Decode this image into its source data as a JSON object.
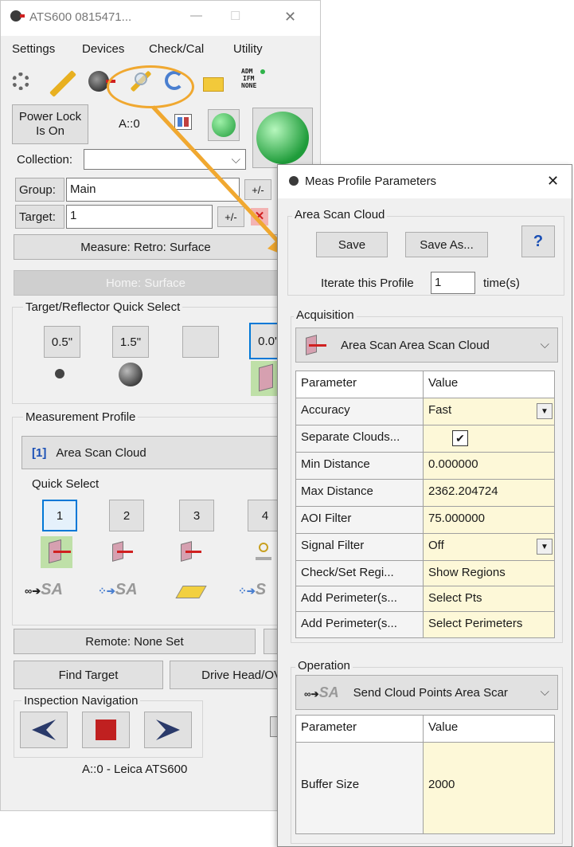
{
  "main": {
    "title": "ATS600 0815471...",
    "window_controls": {
      "minimize": "—",
      "maximize": "☐",
      "close": "✕"
    },
    "menu": [
      "Settings",
      "Devices",
      "Check/Cal",
      "Utility"
    ],
    "status_lines": [
      "ADM",
      "IFM",
      "NONE"
    ],
    "power_lock": [
      "Power Lock",
      "Is On"
    ],
    "station_label": "A::0",
    "collection_label": "Collection:",
    "collection_value": "",
    "group_label": "Group:",
    "group_value": "Main",
    "target_label": "Target:",
    "target_value": "1",
    "plusminus": "+/-",
    "measure_button": "Measure: Retro: Surface",
    "home_button": "Home: Surface",
    "quick_select_title": "Target/Reflector Quick Select",
    "target_buttons": [
      "0.5\"",
      "1.5\"",
      "",
      "0.0'"
    ],
    "profile_title": "Measurement Profile",
    "profile_index": "[1]",
    "profile_name": "Area Scan Cloud",
    "quick_select_label": "Quick Select",
    "quick_buttons": [
      "1",
      "2",
      "3",
      "4"
    ],
    "remote_button": "Remote: None Set",
    "find_target": "Find Target",
    "drive_head": "Drive Head/OV",
    "inspection_nav": "Inspection Navigation",
    "footer": "A::0 - Leica ATS600"
  },
  "dialog": {
    "title": "Meas Profile Parameters",
    "close": "✕",
    "section_title": "Area Scan Cloud",
    "save": "Save",
    "save_as": "Save As...",
    "help": "?",
    "iterate_label": "Iterate this Profile",
    "iterate_value": "1",
    "iterate_unit": "time(s)",
    "acquisition_label": "Acquisition",
    "acquisition_value": "Area Scan Area Scan Cloud",
    "param_header": "Parameter",
    "value_header": "Value",
    "params": [
      {
        "name": "Accuracy",
        "value": "Fast"
      },
      {
        "name": "Separate Clouds...",
        "value": "✔"
      },
      {
        "name": "Min Distance",
        "value": "0.000000"
      },
      {
        "name": "Max Distance",
        "value": "2362.204724"
      },
      {
        "name": "AOI Filter",
        "value": "75.000000"
      },
      {
        "name": "Signal Filter",
        "value": "Off"
      },
      {
        "name": "Check/Set Regi...",
        "value": "Show Regions"
      },
      {
        "name": "Add Perimeter(s...",
        "value": "Select Pts"
      },
      {
        "name": "Add Perimeter(s...",
        "value": "Select Perimeters"
      }
    ],
    "operation_label": "Operation",
    "operation_value": "Send Cloud Points Area Scar",
    "op_params": [
      {
        "name": "Buffer Size",
        "value": "2000"
      }
    ]
  },
  "colors": {
    "window_bg": "#f0f0f0",
    "value_cell": "#fdf8d8",
    "highlight": "#f0a830",
    "green_button": "#2fb34a",
    "selected_border": "#0078d7"
  }
}
